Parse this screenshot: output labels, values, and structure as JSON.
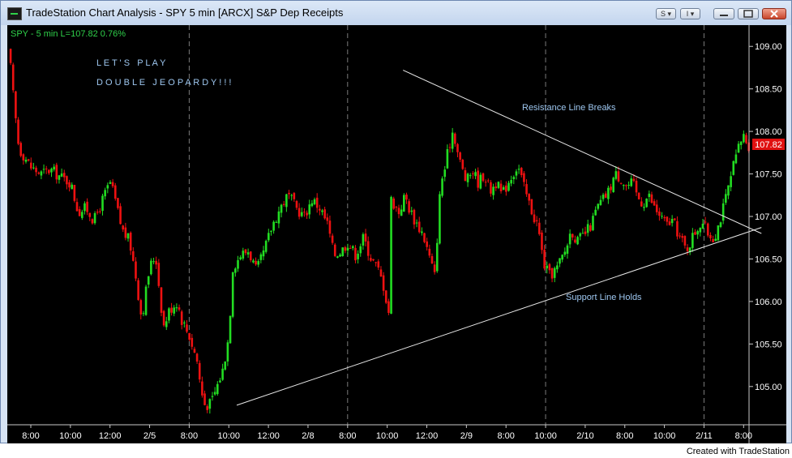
{
  "window": {
    "title": "TradeStation Chart Analysis - SPY 5 min [ARCX] S&P Dep Receipts",
    "btn_s": "S ▾",
    "btn_i": "I ▾"
  },
  "footer": "Created with TradeStation",
  "colors": {
    "background": "#000000",
    "up": "#22dd22",
    "down": "#ee1111",
    "price_label_bg": "#e01010",
    "annotation": "#9ec7f0",
    "info": "#2fd14a"
  },
  "chart_data": {
    "type": "candlestick",
    "info_line": "SPY - 5 min  L=107.82  0.76%",
    "symbol": "SPY",
    "interval": "5 min",
    "last_price": "107.82",
    "change_pct": "0.76%",
    "ylim": [
      104.55,
      109.25
    ],
    "y_ticks": [
      "109.00",
      "108.50",
      "108.00",
      "107.50",
      "107.00",
      "106.50",
      "106.00",
      "105.50",
      "105.00"
    ],
    "x_ticks": [
      "8:00",
      "10:00",
      "12:00",
      "2/5",
      "8:00",
      "10:00",
      "12:00",
      "2/8",
      "8:00",
      "10:00",
      "12:00",
      "2/9",
      "8:00",
      "10:00",
      "2/10",
      "8:00",
      "10:00",
      "2/11",
      "8:00"
    ],
    "session_breaks": [
      4,
      8,
      13,
      17
    ],
    "annotations": {
      "game1": "L E T ' S   P L A Y",
      "game2": "D O U B L E   J E O P A R D Y ! ! !",
      "resistance": "Resistance Line Breaks",
      "support": "Support Line Holds"
    },
    "resistance_line": {
      "from": [
        9.4,
        108.72
      ],
      "to": [
        18.45,
        106.8
      ]
    },
    "support_line": {
      "from": [
        5.2,
        104.78
      ],
      "to": [
        18.45,
        106.87
      ]
    },
    "price_path": [
      [
        -0.55,
        108.95
      ],
      [
        -0.42,
        108.3
      ],
      [
        -0.3,
        107.8
      ],
      [
        -0.15,
        107.7
      ],
      [
        0.0,
        107.58
      ],
      [
        0.25,
        107.5
      ],
      [
        0.5,
        107.55
      ],
      [
        0.8,
        107.45
      ],
      [
        1.0,
        107.4
      ],
      [
        1.2,
        107.05
      ],
      [
        1.4,
        107.1
      ],
      [
        1.6,
        106.95
      ],
      [
        1.8,
        107.18
      ],
      [
        2.0,
        107.4
      ],
      [
        2.1,
        107.25
      ],
      [
        2.3,
        106.85
      ],
      [
        2.5,
        106.7
      ],
      [
        2.65,
        106.3
      ],
      [
        2.8,
        105.8
      ],
      [
        3.0,
        106.4
      ],
      [
        3.15,
        106.55
      ],
      [
        3.35,
        105.7
      ],
      [
        3.5,
        105.9
      ],
      [
        3.7,
        106.0
      ],
      [
        3.8,
        105.8
      ],
      [
        4.0,
        105.6
      ],
      [
        4.2,
        105.3
      ],
      [
        4.3,
        104.95
      ],
      [
        4.4,
        104.78
      ],
      [
        4.55,
        104.8
      ],
      [
        4.7,
        105.0
      ],
      [
        4.85,
        105.2
      ],
      [
        5.0,
        105.6
      ],
      [
        5.1,
        106.4
      ],
      [
        5.3,
        106.55
      ],
      [
        5.5,
        106.6
      ],
      [
        5.7,
        106.35
      ],
      [
        5.9,
        106.6
      ],
      [
        6.1,
        106.9
      ],
      [
        6.35,
        107.15
      ],
      [
        6.5,
        107.25
      ],
      [
        6.7,
        107.1
      ],
      [
        6.9,
        107.0
      ],
      [
        7.1,
        107.2
      ],
      [
        7.3,
        107.1
      ],
      [
        7.5,
        106.9
      ],
      [
        7.65,
        106.55
      ],
      [
        7.85,
        106.6
      ],
      [
        8.0,
        106.7
      ],
      [
        8.2,
        106.55
      ],
      [
        8.4,
        106.75
      ],
      [
        8.6,
        106.5
      ],
      [
        8.75,
        106.4
      ],
      [
        8.9,
        106.2
      ],
      [
        9.05,
        105.85
      ],
      [
        9.1,
        107.2
      ],
      [
        9.3,
        107.05
      ],
      [
        9.45,
        107.25
      ],
      [
        9.55,
        107.1
      ],
      [
        9.7,
        106.95
      ],
      [
        9.9,
        106.8
      ],
      [
        10.05,
        106.55
      ],
      [
        10.2,
        106.3
      ],
      [
        10.35,
        107.4
      ],
      [
        10.45,
        107.55
      ],
      [
        10.55,
        107.8
      ],
      [
        10.65,
        108.0
      ],
      [
        10.7,
        107.95
      ],
      [
        10.8,
        107.7
      ],
      [
        11.0,
        107.4
      ],
      [
        11.15,
        107.55
      ],
      [
        11.3,
        107.4
      ],
      [
        11.45,
        107.5
      ],
      [
        11.6,
        107.3
      ],
      [
        11.75,
        107.4
      ],
      [
        11.9,
        107.25
      ],
      [
        12.1,
        107.45
      ],
      [
        12.3,
        107.6
      ],
      [
        12.45,
        107.35
      ],
      [
        12.55,
        107.2
      ],
      [
        12.7,
        107.0
      ],
      [
        12.8,
        106.9
      ],
      [
        12.95,
        106.45
      ],
      [
        13.1,
        106.3
      ],
      [
        13.3,
        106.4
      ],
      [
        13.5,
        106.6
      ],
      [
        13.65,
        106.85
      ],
      [
        13.8,
        106.7
      ],
      [
        14.0,
        106.8
      ],
      [
        14.15,
        106.9
      ],
      [
        14.3,
        107.1
      ],
      [
        14.45,
        107.2
      ],
      [
        14.6,
        107.3
      ],
      [
        14.75,
        107.5
      ],
      [
        14.9,
        107.45
      ],
      [
        15.05,
        107.35
      ],
      [
        15.2,
        107.4
      ],
      [
        15.3,
        107.25
      ],
      [
        15.45,
        107.15
      ],
      [
        15.6,
        107.25
      ],
      [
        15.75,
        107.1
      ],
      [
        15.9,
        107.0
      ],
      [
        16.05,
        106.9
      ],
      [
        16.2,
        106.95
      ],
      [
        16.4,
        106.75
      ],
      [
        16.55,
        106.6
      ],
      [
        16.75,
        106.8
      ],
      [
        16.95,
        106.95
      ],
      [
        17.1,
        106.8
      ],
      [
        17.25,
        106.75
      ],
      [
        17.4,
        106.95
      ],
      [
        17.6,
        107.3
      ],
      [
        17.75,
        107.6
      ],
      [
        17.9,
        107.85
      ],
      [
        18.0,
        107.95
      ],
      [
        18.15,
        107.82
      ]
    ]
  }
}
